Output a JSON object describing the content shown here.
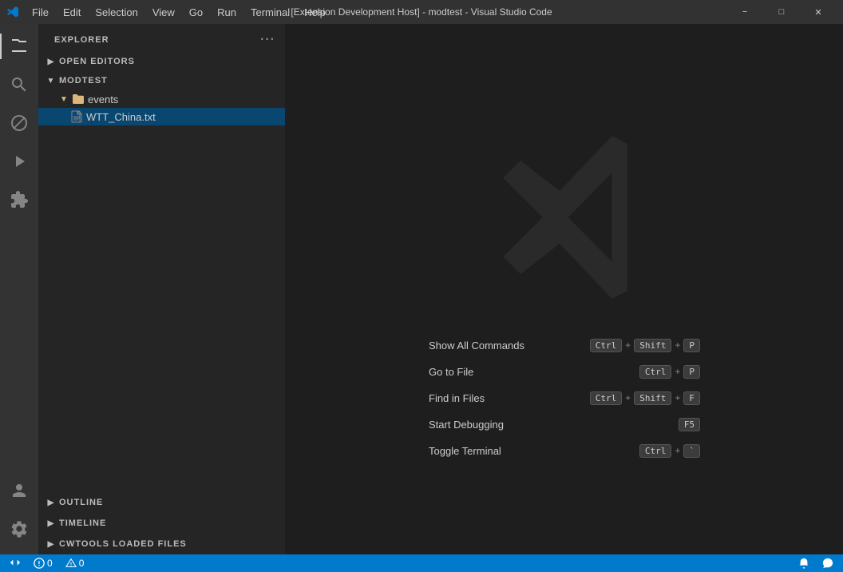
{
  "titlebar": {
    "title": "[Extension Development Host] - modtest - Visual Studio Code",
    "menu": [
      "File",
      "Edit",
      "Selection",
      "View",
      "Go",
      "Run",
      "Terminal",
      "Help"
    ],
    "controls": [
      "minimize",
      "maximize",
      "close"
    ]
  },
  "activity_bar": {
    "items": [
      {
        "name": "explorer",
        "icon": "files-icon",
        "active": true
      },
      {
        "name": "search",
        "icon": "search-icon",
        "active": false
      },
      {
        "name": "source-control",
        "icon": "git-icon",
        "active": false
      },
      {
        "name": "run",
        "icon": "run-icon",
        "active": false
      },
      {
        "name": "extensions",
        "icon": "extensions-icon",
        "active": false
      }
    ],
    "bottom_items": [
      {
        "name": "account",
        "icon": "account-icon"
      },
      {
        "name": "settings",
        "icon": "settings-icon"
      }
    ]
  },
  "sidebar": {
    "header": "EXPLORER",
    "more_label": "···",
    "sections": [
      {
        "id": "open-editors",
        "label": "OPEN EDITORS",
        "collapsed": true
      },
      {
        "id": "modtest",
        "label": "MODTEST",
        "collapsed": false,
        "children": [
          {
            "id": "events",
            "label": "events",
            "type": "folder",
            "expanded": true,
            "children": [
              {
                "id": "wtt-china",
                "label": "WTT_China.txt",
                "type": "file",
                "selected": true
              }
            ]
          }
        ]
      }
    ],
    "bottom_sections": [
      {
        "id": "outline",
        "label": "OUTLINE",
        "collapsed": true
      },
      {
        "id": "timeline",
        "label": "TIMELINE",
        "collapsed": true
      },
      {
        "id": "cwtools",
        "label": "CWTOOLS LOADED FILES",
        "collapsed": true
      }
    ]
  },
  "editor": {
    "welcome": {
      "shortcuts": [
        {
          "label": "Show All Commands",
          "keys": [
            "Ctrl",
            "+",
            "Shift",
            "+",
            "P"
          ]
        },
        {
          "label": "Go to File",
          "keys": [
            "Ctrl",
            "+",
            "P"
          ]
        },
        {
          "label": "Find in Files",
          "keys": [
            "Ctrl",
            "+",
            "Shift",
            "+",
            "F"
          ]
        },
        {
          "label": "Start Debugging",
          "keys": [
            "F5"
          ]
        },
        {
          "label": "Toggle Terminal",
          "keys": [
            "Ctrl",
            "+",
            "`"
          ]
        }
      ]
    }
  },
  "statusbar": {
    "left_items": [
      {
        "id": "remote",
        "icon": "remote-icon",
        "label": ""
      },
      {
        "id": "errors",
        "icon": "error-icon",
        "label": "0"
      },
      {
        "id": "warnings",
        "icon": "warning-icon",
        "label": "0"
      }
    ],
    "right_items": [
      {
        "id": "notifications",
        "icon": "bell-icon",
        "label": ""
      },
      {
        "id": "feedback",
        "icon": "feedback-icon",
        "label": ""
      }
    ]
  }
}
